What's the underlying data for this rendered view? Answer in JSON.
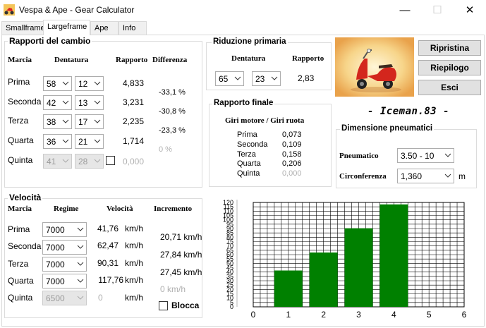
{
  "window": {
    "title": "Vespa & Ape - Gear Calculator",
    "minimize": "—",
    "maximize": "☐",
    "close": "✕"
  },
  "tabs": [
    "Smallframe",
    "Largeframe",
    "Ape",
    "Info"
  ],
  "rapporti": {
    "title": "Rapporti del cambio",
    "headers": {
      "marcia": "Marcia",
      "dentatura": "Dentatura",
      "rapporto": "Rapporto",
      "differenza": "Differenza"
    },
    "rows": [
      {
        "name": "Prima",
        "d1": "58",
        "d2": "12",
        "rapporto": "4,833"
      },
      {
        "name": "Seconda",
        "d1": "42",
        "d2": "13",
        "rapporto": "3,231"
      },
      {
        "name": "Terza",
        "d1": "38",
        "d2": "17",
        "rapporto": "2,235"
      },
      {
        "name": "Quarta",
        "d1": "36",
        "d2": "21",
        "rapporto": "1,714"
      },
      {
        "name": "Quinta",
        "d1": "41",
        "d2": "28",
        "rapporto": "0,000"
      }
    ],
    "diff": [
      "-33,1 %",
      "-30,8 %",
      "-23,3 %",
      "0 %"
    ]
  },
  "riduzione": {
    "title": "Riduzione primaria",
    "headers": {
      "dentatura": "Dentatura",
      "rapporto": "Rapporto"
    },
    "d1": "65",
    "d2": "23",
    "rapporto": "2,83"
  },
  "finale": {
    "title": "Rapporto finale",
    "subtitle": "Giri motore / Giri ruota",
    "rows": [
      {
        "name": "Prima",
        "value": "0,073"
      },
      {
        "name": "Seconda",
        "value": "0,109"
      },
      {
        "name": "Terza",
        "value": "0,158"
      },
      {
        "name": "Quarta",
        "value": "0,206"
      },
      {
        "name": "Quinta",
        "value": "0,000"
      }
    ]
  },
  "buttons": {
    "ripristina": "Ripristina",
    "riepilogo": "Riepilogo",
    "esci": "Esci"
  },
  "signature": "- Iceman.83 -",
  "pneumatici": {
    "title": "Dimensione pneumatici",
    "label_pneumatico": "Pneumatico",
    "pneumatico": "3.50 - 10",
    "label_circonferenza": "Circonferenza",
    "circonferenza": "1,360",
    "unit": "m"
  },
  "velocita": {
    "title": "Velocità",
    "headers": {
      "marcia": "Marcia",
      "regime": "Regime",
      "velocita": "Velocità",
      "incremento": "Incremento"
    },
    "unit": "km/h",
    "rows": [
      {
        "name": "Prima",
        "regime": "7000",
        "velocita": "41,76"
      },
      {
        "name": "Seconda",
        "regime": "7000",
        "velocita": "62,47"
      },
      {
        "name": "Terza",
        "regime": "7000",
        "velocita": "90,31"
      },
      {
        "name": "Quarta",
        "regime": "7000",
        "velocita": "117,76"
      },
      {
        "name": "Quinta",
        "regime": "6500",
        "velocita": "0"
      }
    ],
    "incrementi": [
      "20,71 km/h",
      "27,84 km/h",
      "27,45 km/h",
      "0 km/h"
    ],
    "blocca": "Blocca"
  },
  "colors": {
    "bar": "#008000",
    "accent": "#0078d7"
  },
  "chart_data": {
    "type": "bar",
    "x": [
      1,
      2,
      3,
      4
    ],
    "values": [
      41.76,
      62.47,
      90.31,
      117.76
    ],
    "xlim": [
      0,
      6
    ],
    "ylim": [
      0,
      120
    ],
    "xticks": [
      "0",
      "1",
      "2",
      "3",
      "4",
      "5",
      "6"
    ],
    "yticks": [
      "0",
      "5",
      "10",
      "15",
      "20",
      "25",
      "30",
      "35",
      "40",
      "45",
      "50",
      "55",
      "60",
      "65",
      "70",
      "75",
      "80",
      "85",
      "90",
      "95",
      "100",
      "105",
      "110",
      "115",
      "120"
    ],
    "grid": true
  }
}
